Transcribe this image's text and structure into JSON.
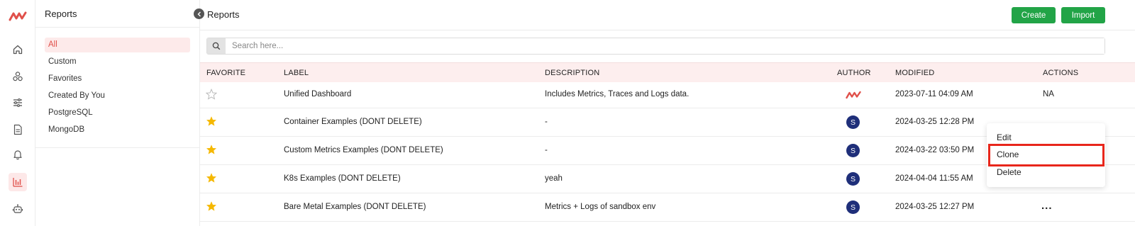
{
  "icons": {
    "logo": "middleware-logo",
    "nav": [
      "home-icon",
      "apps-icon",
      "filters-icon",
      "document-icon",
      "bell-icon",
      "chart-icon",
      "robot-icon"
    ],
    "collapse": "chevron-left-icon",
    "search": "search-icon",
    "favorite_empty": "star-outline-icon",
    "favorite_filled": "star-filled-icon",
    "more": "more-icon"
  },
  "colors": {
    "accent": "#e0504a",
    "button": "#22a447",
    "header_bg": "#fdeeee",
    "avatar": "#1f2f7a",
    "star": "#f5b800",
    "highlight": "#e8261b"
  },
  "sidebar": {
    "title": "Reports",
    "items": [
      {
        "label": "All",
        "active": true
      },
      {
        "label": "Custom"
      },
      {
        "label": "Favorites"
      },
      {
        "label": "Created By You"
      },
      {
        "label": "PostgreSQL"
      },
      {
        "label": "MongoDB"
      }
    ]
  },
  "header": {
    "title": "Reports",
    "create_label": "Create",
    "import_label": "Import"
  },
  "search": {
    "placeholder": "Search here...",
    "value": ""
  },
  "table": {
    "columns": [
      "FAVORITE",
      "LABEL",
      "DESCRIPTION",
      "AUTHOR",
      "MODIFIED",
      "ACTIONS"
    ],
    "rows": [
      {
        "favorite": false,
        "label": "Unified Dashboard",
        "description": "Includes Metrics, Traces and Logs data.",
        "author": "",
        "modified": "2023-07-11 04:09 AM",
        "actions": "NA"
      },
      {
        "favorite": true,
        "label": "Container Examples (DONT DELETE)",
        "description": "-",
        "author": "S",
        "modified": "2024-03-25 12:28 PM",
        "actions": ""
      },
      {
        "favorite": true,
        "label": "Custom Metrics Examples (DONT DELETE)",
        "description": "-",
        "author": "S",
        "modified": "2024-03-22 03:50 PM",
        "actions": ""
      },
      {
        "favorite": true,
        "label": "K8s Examples (DONT DELETE)",
        "description": "yeah",
        "author": "S",
        "modified": "2024-04-04 11:55 AM",
        "actions": ""
      },
      {
        "favorite": true,
        "label": "Bare Metal Examples (DONT DELETE)",
        "description": "Metrics + Logs of sandbox env",
        "author": "S",
        "modified": "2024-03-25 12:27 PM",
        "actions": "..."
      }
    ]
  },
  "context_menu": {
    "items": [
      "Edit",
      "Clone",
      "Delete"
    ],
    "highlighted": "Clone"
  }
}
